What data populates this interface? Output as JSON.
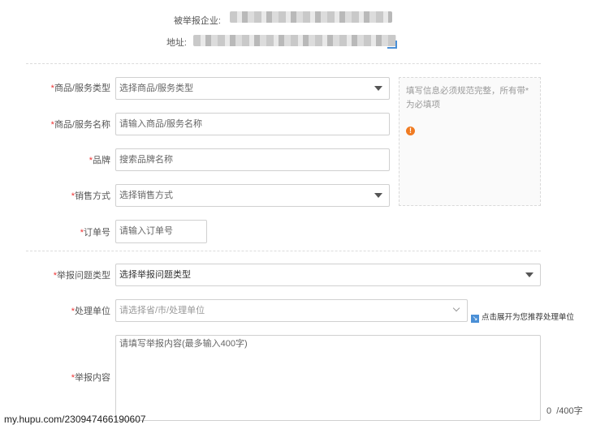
{
  "company": {
    "label": "被举报企业:",
    "address_label": "地址:"
  },
  "form": {
    "product_type": {
      "label": "商品/服务类型",
      "placeholder": "选择商品/服务类型"
    },
    "product_name": {
      "label": "商品/服务名称",
      "placeholder": "请输入商品/服务名称"
    },
    "brand": {
      "label": "品牌",
      "placeholder": "搜索品牌名称"
    },
    "sales_method": {
      "label": "销售方式",
      "placeholder": "选择销售方式"
    },
    "order_no": {
      "label": "订单号",
      "placeholder": "请输入订单号"
    },
    "issue_type": {
      "label": "举报问题类型",
      "placeholder": "选择举报问题类型"
    },
    "handler": {
      "label": "处理单位",
      "placeholder": "请选择省/市/处理单位",
      "hint": "点击展开为您推荐处理单位"
    },
    "content": {
      "label": "举报内容",
      "placeholder": "请填写举报内容(最多输入400字)",
      "count": "0",
      "max": "/400字"
    }
  },
  "required_mark": "*",
  "tip": {
    "text": "填写信息必须规范完整，所有带*为必填项"
  },
  "watermark": "my.hupu.com/230947466190607"
}
